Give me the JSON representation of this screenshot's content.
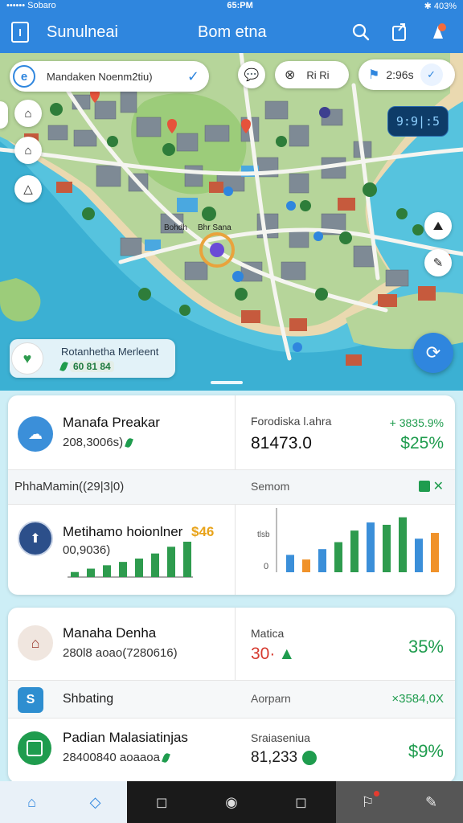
{
  "status": {
    "carrier": "•••••• Sobaro",
    "time": "65:PM",
    "battery": "✱ 403%"
  },
  "header": {
    "title": "Sunulneai",
    "subtitle": "Bom etna",
    "menu_icon": "menu-icon",
    "search_icon": "search-icon",
    "share_icon": "share-icon",
    "alert_icon": "alert-icon"
  },
  "map": {
    "search": {
      "lead": "e",
      "text": "Mandaken Noenm2tiu)",
      "check": "✓"
    },
    "layer_chip": {
      "icon": "layers-icon",
      "text": "Ri Ri"
    },
    "time_chip": {
      "icon": "flag-icon",
      "text": "2:96s",
      "check": "✓"
    },
    "dark_chip": "9:9|:5",
    "pin_labels": [
      "Bohdh",
      "Bhr Sana"
    ],
    "place_card": {
      "title": "Rotanhetha Merleent",
      "tag": "60 81 84"
    },
    "left_tools": [
      "briefcase-icon",
      "home-icon",
      "warning-icon"
    ],
    "right_tools": [
      "image-icon",
      "measure-icon"
    ]
  },
  "cardA": {
    "title": "Manafa Preakar",
    "sub": "208,3006s)",
    "right_label": "Forodiska l.ahra",
    "right_delta": "+ 3835.9%",
    "right_value": "81473.0",
    "right_pct": "$25%",
    "strip_left": "PhhaMamin((29|3|0)",
    "strip_right": "Semom",
    "strip_action": "✕",
    "row2_title": "Metihamo hoionlner",
    "row2_value": "$46",
    "row2_sub": "00,9036)",
    "mini_chart": [
      6,
      10,
      14,
      18,
      22,
      28,
      36,
      42
    ],
    "big_chart": {
      "y_top_label": "tlsb",
      "y_zero_label": "0",
      "values": [
        {
          "v": 30,
          "c": "#3b8fd9"
        },
        {
          "v": 22,
          "c": "#f0922a"
        },
        {
          "v": 40,
          "c": "#3b8fd9"
        },
        {
          "v": 52,
          "c": "#2e9b4e"
        },
        {
          "v": 72,
          "c": "#2e9b4e"
        },
        {
          "v": 86,
          "c": "#3b8fd9"
        },
        {
          "v": 82,
          "c": "#2e9b4e"
        },
        {
          "v": 95,
          "c": "#2e9b4e"
        },
        {
          "v": 58,
          "c": "#3b8fd9"
        },
        {
          "v": 68,
          "c": "#f0922a"
        }
      ]
    }
  },
  "cardC": {
    "title": "Manaha Denha",
    "sub": "280l8 aoao(7280616)",
    "right_label": "Matica",
    "right_value": "30·",
    "right_pct": "35%",
    "strip_title": "Shbating",
    "strip_right": "Aorparn",
    "strip_value": "×3584,0X",
    "row2_title": "Padian Malasiatinjas",
    "row2_sub": "28400840 aoaaoa",
    "row2_label": "Sraiaseniua",
    "row2_value": "81,233",
    "row2_pct": "$9%"
  },
  "colors": {
    "brand": "#2f86de",
    "green": "#1f9c4e",
    "red": "#d63a2f",
    "orange": "#f0922a"
  },
  "nav": [
    "home-icon",
    "diamond-icon",
    "back-icon",
    "circle-icon",
    "square-icon",
    "bookmark-icon",
    "edit-icon"
  ]
}
